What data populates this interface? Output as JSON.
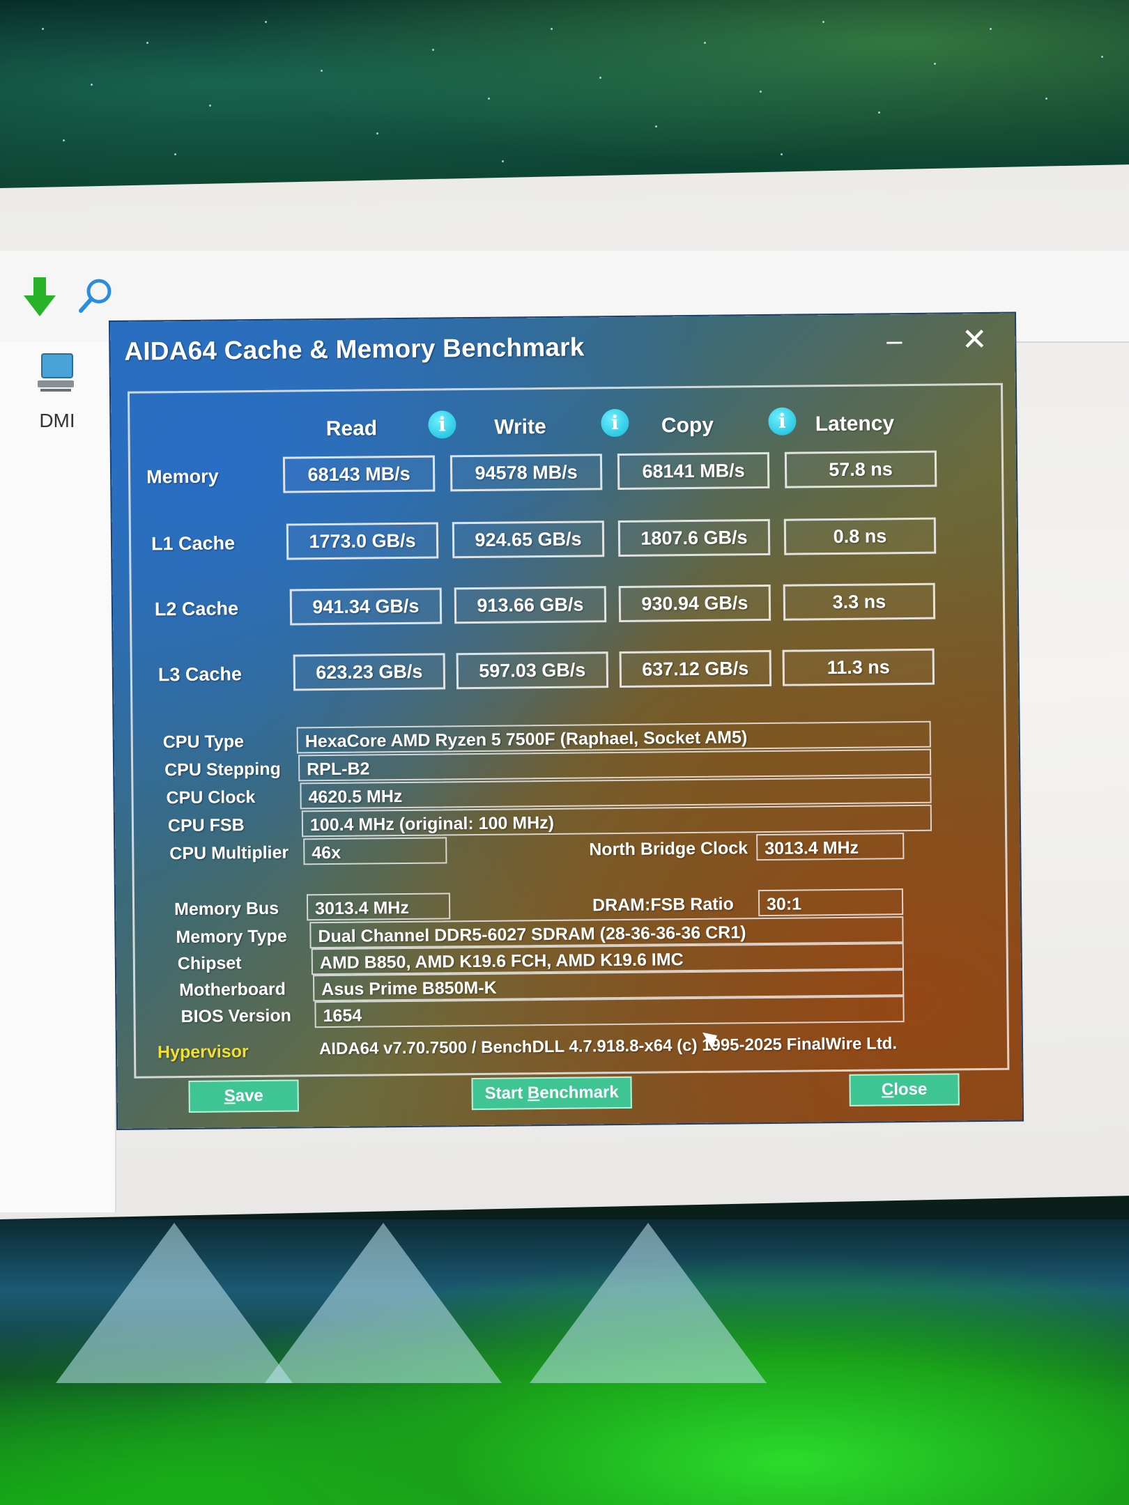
{
  "desktop": {
    "dmi_label": "DMI"
  },
  "dialog": {
    "title": "AIDA64 Cache & Memory Benchmark",
    "minimize_glyph": "–",
    "close_glyph": "✕"
  },
  "columns": {
    "read": "Read",
    "write": "Write",
    "copy": "Copy",
    "latency": "Latency",
    "info_glyph": "i"
  },
  "benchmark_rows": [
    {
      "label": "Memory",
      "read": "68143 MB/s",
      "write": "94578 MB/s",
      "copy": "68141 MB/s",
      "latency": "57.8 ns"
    },
    {
      "label": "L1 Cache",
      "read": "1773.0 GB/s",
      "write": "924.65 GB/s",
      "copy": "1807.6 GB/s",
      "latency": "0.8 ns"
    },
    {
      "label": "L2 Cache",
      "read": "941.34 GB/s",
      "write": "913.66 GB/s",
      "copy": "930.94 GB/s",
      "latency": "3.3 ns"
    },
    {
      "label": "L3 Cache",
      "read": "623.23 GB/s",
      "write": "597.03 GB/s",
      "copy": "637.12 GB/s",
      "latency": "11.3 ns"
    }
  ],
  "system_info": {
    "cpu_type_label": "CPU Type",
    "cpu_type": "HexaCore AMD Ryzen 5 7500F  (Raphael, Socket AM5)",
    "cpu_stepping_label": "CPU Stepping",
    "cpu_stepping": "RPL-B2",
    "cpu_clock_label": "CPU Clock",
    "cpu_clock": "4620.5 MHz",
    "cpu_fsb_label": "CPU FSB",
    "cpu_fsb": "100.4 MHz  (original: 100 MHz)",
    "cpu_multiplier_label": "CPU Multiplier",
    "cpu_multiplier": "46x",
    "north_bridge_clock_label": "North Bridge Clock",
    "north_bridge_clock": "3013.4 MHz",
    "memory_bus_label": "Memory Bus",
    "memory_bus": "3013.4 MHz",
    "dram_fsb_ratio_label": "DRAM:FSB Ratio",
    "dram_fsb_ratio": "30:1",
    "memory_type_label": "Memory Type",
    "memory_type": "Dual Channel DDR5-6027 SDRAM  (28-36-36-36 CR1)",
    "chipset_label": "Chipset",
    "chipset": "AMD B850, AMD K19.6 FCH, AMD K19.6 IMC",
    "motherboard_label": "Motherboard",
    "motherboard": "Asus Prime B850M-K",
    "bios_version_label": "BIOS Version",
    "bios_version": "1654"
  },
  "footer": {
    "hypervisor": "Hypervisor",
    "version": "AIDA64 v7.70.7500 / BenchDLL 4.7.918.8-x64  (c) 1995-2025 FinalWire Ltd."
  },
  "buttons": {
    "save_first": "S",
    "save_rest": "ave",
    "start_pre": "Start ",
    "start_u": "B",
    "start_post": "enchmark",
    "close_first": "C",
    "close_rest": "lose"
  },
  "colors": {
    "button_bg": "#3fc493",
    "hypervisor": "#f2e02a",
    "info_icon": "#12b8d8"
  }
}
